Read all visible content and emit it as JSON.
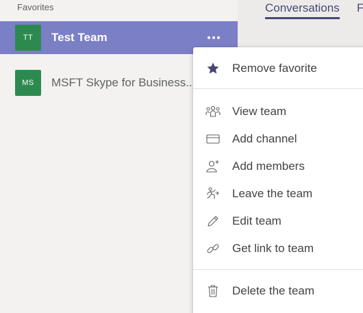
{
  "sidebar": {
    "section_title": "Favorites",
    "teams": [
      {
        "initials": "TT",
        "name": "Test Team",
        "avatar_color": "#2d8a4f"
      },
      {
        "initials": "MS",
        "name": "MSFT Skype for Business...",
        "avatar_color": "#2d8a4f"
      }
    ],
    "active_color": "#7b7fc6",
    "more_icon": "more-horizontal-icon"
  },
  "tabs": [
    {
      "label": "Conversations",
      "active": true
    },
    {
      "label": "F",
      "active": false
    }
  ],
  "context_menu": {
    "items": [
      {
        "label": "Remove favorite",
        "icon": "star-filled-icon"
      },
      {
        "label": "View team",
        "icon": "team-icon"
      },
      {
        "label": "Add channel",
        "icon": "channel-icon"
      },
      {
        "label": "Add members",
        "icon": "add-person-icon"
      },
      {
        "label": "Leave the team",
        "icon": "leave-icon"
      },
      {
        "label": "Edit team",
        "icon": "pencil-icon"
      },
      {
        "label": "Get link to team",
        "icon": "link-icon"
      },
      {
        "label": "Delete the team",
        "icon": "trash-icon"
      }
    ]
  },
  "colors": {
    "accent": "#464775",
    "star": "#464775"
  }
}
